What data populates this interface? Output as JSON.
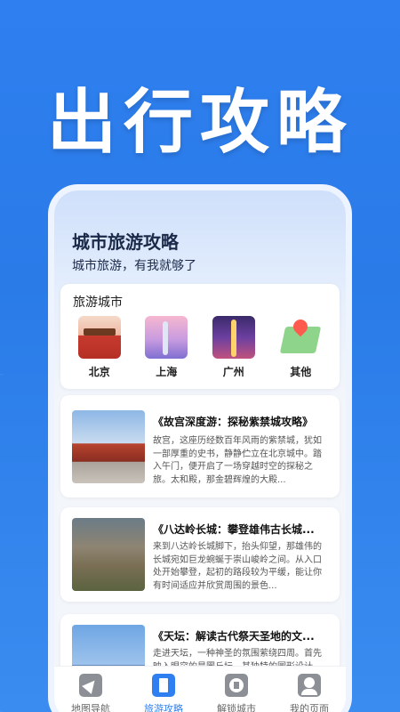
{
  "headline": "出行攻略",
  "app": {
    "title": "城市旅游攻略",
    "subtitle": "城市旅游，有我就够了"
  },
  "cities": {
    "title": "旅游城市",
    "items": [
      {
        "label": "北京",
        "icon": "beijing-gate-image"
      },
      {
        "label": "上海",
        "icon": "shanghai-skyline-image"
      },
      {
        "label": "广州",
        "icon": "guangzhou-tower-image"
      },
      {
        "label": "其他",
        "icon": "map-pin-icon"
      }
    ]
  },
  "articles": [
    {
      "title": "《故宫深度游：探秘紫禁城攻略》",
      "body": "故宫，这座历经数百年风雨的紫禁城，犹如一部厚重的史书，静静伫立在北京城中。踏入午门，便开启了一场穿越时空的探秘之旅。太和殿，那金碧辉煌的大殿..."
    },
    {
      "title": "《八达岭长城：攀登雄伟古长城...",
      "body": "来到八达岭长城脚下，抬头仰望，那雄伟的长城宛如巨龙蜿蜒于崇山峻岭之间。从入口处开始攀登，起初的路段较为平缓，能让你有时间适应并欣赏周围的景色..."
    },
    {
      "title": "《天坛：解读古代祭天圣地的文...",
      "body": "走进天坛，一种神圣的氛围萦绕四周。首先映入眼帘的是圜丘坛，其独特的圆形设计..."
    }
  ],
  "tabs": [
    {
      "label": "地图导航",
      "icon": "navigation-arrow-icon",
      "active": false
    },
    {
      "label": "旅游攻略",
      "icon": "book-icon",
      "active": true
    },
    {
      "label": "解锁城市",
      "icon": "city-icon",
      "active": false
    },
    {
      "label": "我的页面",
      "icon": "user-icon",
      "active": false
    }
  ],
  "colors": {
    "accent": "#2f7ff0",
    "inactive_tab": "#8c8f95"
  }
}
